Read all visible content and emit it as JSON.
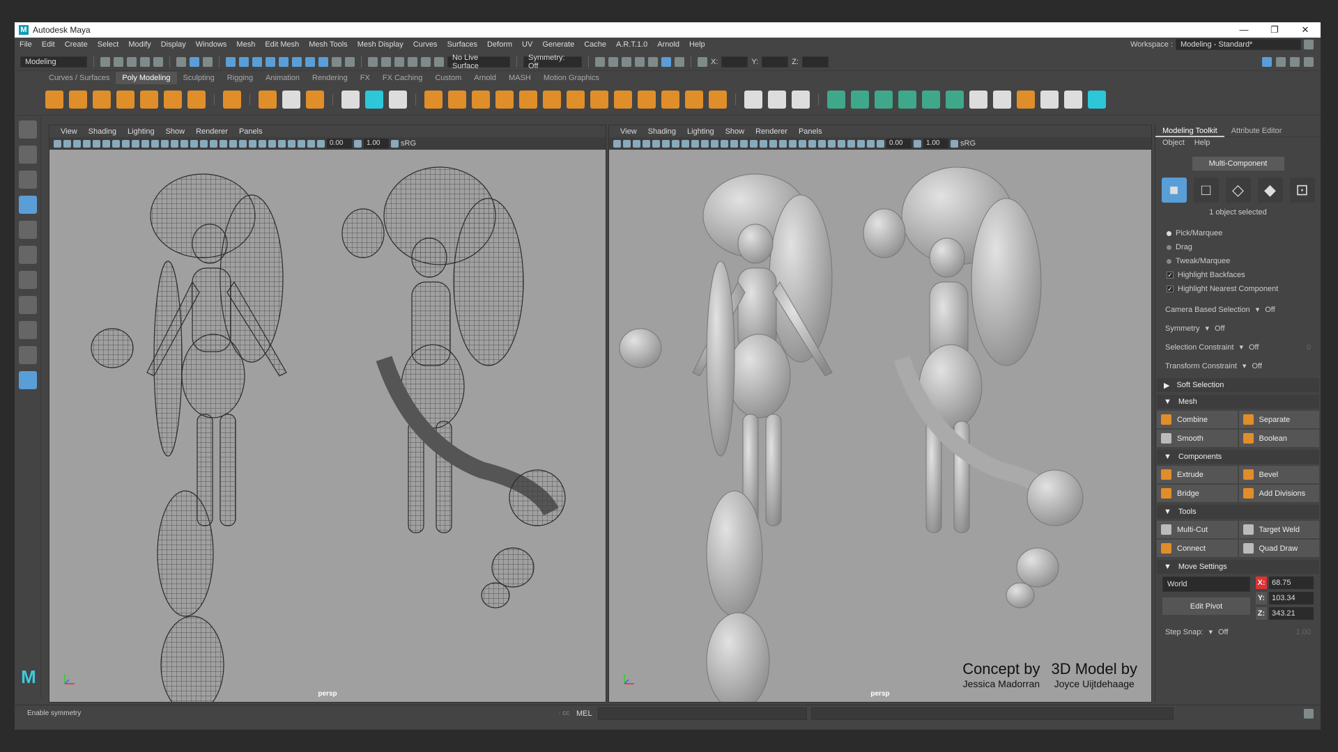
{
  "window": {
    "title": "Autodesk Maya",
    "minimize": "—",
    "restore": "❐",
    "close": "✕"
  },
  "menubar": {
    "items": [
      "File",
      "Edit",
      "Create",
      "Select",
      "Modify",
      "Display",
      "Windows",
      "Mesh",
      "Edit Mesh",
      "Mesh Tools",
      "Mesh Display",
      "Curves",
      "Surfaces",
      "Deform",
      "UV",
      "Generate",
      "Cache",
      "A.R.T.1.0",
      "Arnold",
      "Help"
    ],
    "workspace_label": "Workspace :",
    "workspace_value": "Modeling - Standard*"
  },
  "statusline": {
    "menu_set": "Modeling",
    "live_surface": "No Live Surface",
    "symmetry": "Symmetry: Off",
    "x_label": "X:",
    "y_label": "Y:",
    "z_label": "Z:"
  },
  "shelf_tabs": [
    "Curves / Surfaces",
    "Poly Modeling",
    "Sculpting",
    "Rigging",
    "Animation",
    "Rendering",
    "FX",
    "FX Caching",
    "Custom",
    "Arnold",
    "MASH",
    "Motion Graphics"
  ],
  "shelf_active": "Poly Modeling",
  "viewport": {
    "menus": [
      "View",
      "Shading",
      "Lighting",
      "Show",
      "Renderer",
      "Panels"
    ],
    "near": "0.00",
    "far": "1.00",
    "colorspace": "sRG",
    "camera": "persp"
  },
  "credits": {
    "concept_title": "Concept by",
    "concept_name": "Jessica Madorran",
    "model_title": "3D Model by",
    "model_name": "Joyce Uijtdehaage"
  },
  "toolkit": {
    "tab_active": "Modeling Toolkit",
    "tab_other": "Attribute Editor",
    "menu_object": "Object",
    "menu_help": "Help",
    "multi_component": "Multi-Component",
    "object_selected": "1 object selected",
    "pick_marquee": "Pick/Marquee",
    "drag": "Drag",
    "tweak_marquee": "Tweak/Marquee",
    "highlight_backfaces": "Highlight Backfaces",
    "highlight_nearest": "Highlight Nearest Component",
    "camera_based": "Camera Based Selection",
    "symmetry": "Symmetry",
    "selection_constraint": "Selection Constraint",
    "transform_constraint": "Transform Constraint",
    "off": "Off",
    "constraint_value": "0",
    "soft_selection": "Soft Selection",
    "mesh": "Mesh",
    "combine": "Combine",
    "separate": "Separate",
    "smooth": "Smooth",
    "boolean": "Boolean",
    "components": "Components",
    "extrude": "Extrude",
    "bevel": "Bevel",
    "bridge": "Bridge",
    "add_divisions": "Add Divisions",
    "tools": "Tools",
    "multi_cut": "Multi-Cut",
    "target_weld": "Target Weld",
    "connect": "Connect",
    "quad_draw": "Quad Draw",
    "move_settings": "Move Settings",
    "world": "World",
    "edit_pivot": "Edit Pivot",
    "x": "68.75",
    "y": "103.34",
    "z": "343.21",
    "step_snap": "Step Snap:",
    "step_value": "1.00"
  },
  "bottom": {
    "help_line": "Enable symmetry",
    "cmd_lang": "MEL",
    "cmd_prefix": "· cc"
  }
}
